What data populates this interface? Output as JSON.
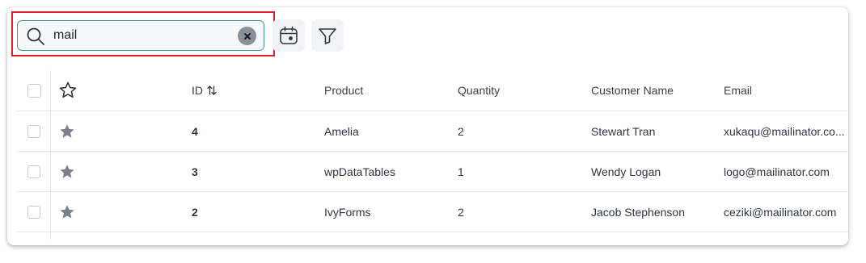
{
  "search": {
    "value": "mail",
    "placeholder": ""
  },
  "toolbar": {
    "calendar_icon": "calendar-icon",
    "filter_icon": "filter-icon"
  },
  "table": {
    "columns": {
      "id": "ID",
      "product": "Product",
      "quantity": "Quantity",
      "customer": "Customer Name",
      "email": "Email"
    },
    "rows": [
      {
        "id": "4",
        "product": "Amelia",
        "quantity": "2",
        "customer": "Stewart Tran",
        "email": "xukaqu@mailinator.co..."
      },
      {
        "id": "3",
        "product": "wpDataTables",
        "quantity": "1",
        "customer": "Wendy Logan",
        "email": "logo@mailinator.com"
      },
      {
        "id": "2",
        "product": "IvyForms",
        "quantity": "2",
        "customer": "Jacob Stephenson",
        "email": "ceziki@mailinator.com"
      }
    ]
  },
  "colors": {
    "highlight": "#d6252c",
    "search_border": "#3a9ca0",
    "star_filled": "#7b818a"
  }
}
